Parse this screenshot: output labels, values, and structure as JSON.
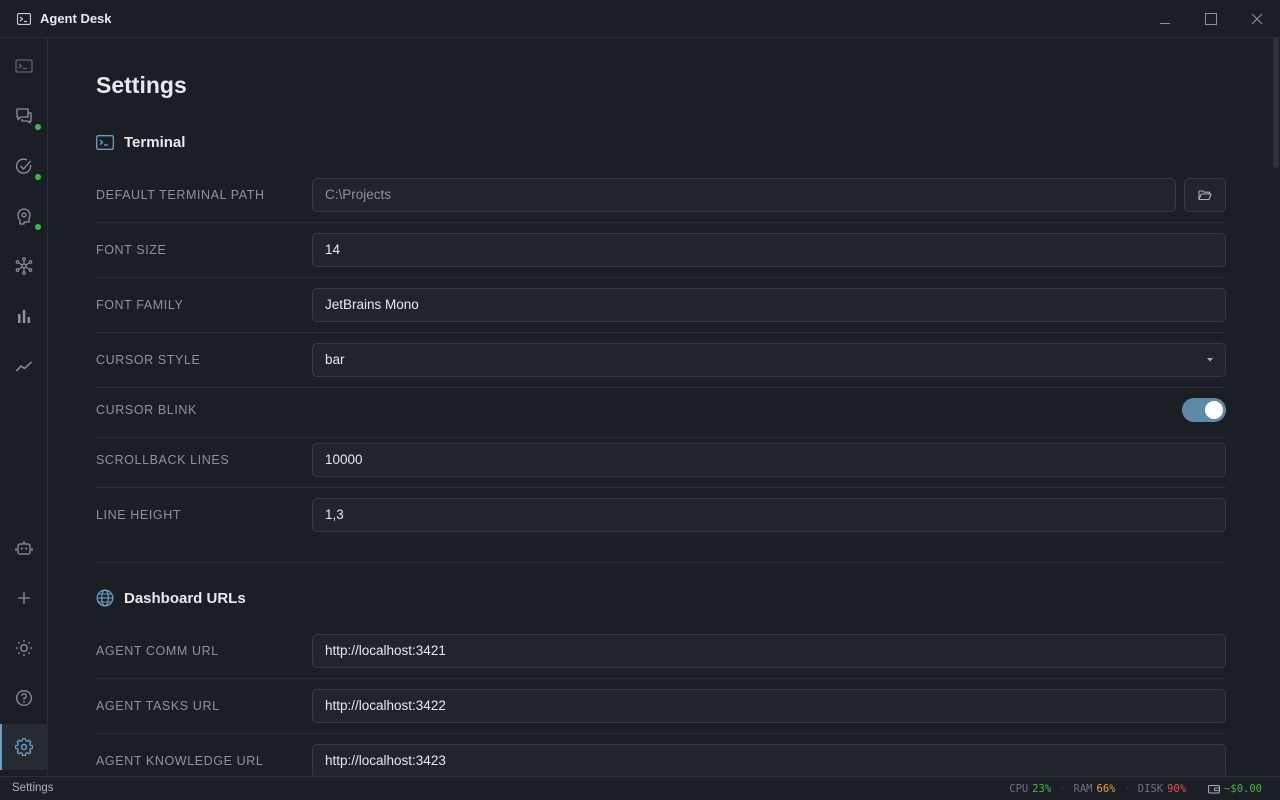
{
  "app": {
    "title": "Agent Desk"
  },
  "page": {
    "title": "Settings"
  },
  "sections": {
    "terminal": {
      "title": "Terminal",
      "rows": {
        "default_path": {
          "label": "DEFAULT TERMINAL PATH",
          "value": "C:\\Projects"
        },
        "font_size": {
          "label": "FONT SIZE",
          "value": "14"
        },
        "font_family": {
          "label": "FONT FAMILY",
          "value": "JetBrains Mono"
        },
        "cursor_style": {
          "label": "CURSOR STYLE",
          "value": "bar"
        },
        "cursor_blink": {
          "label": "CURSOR BLINK",
          "value": true
        },
        "scrollback": {
          "label": "SCROLLBACK LINES",
          "value": "10000"
        },
        "line_height": {
          "label": "LINE HEIGHT",
          "value": "1,3"
        }
      }
    },
    "dashboard": {
      "title": "Dashboard URLs",
      "rows": {
        "comm": {
          "label": "AGENT COMM URL",
          "value": "http://localhost:3421"
        },
        "tasks": {
          "label": "AGENT TASKS URL",
          "value": "http://localhost:3422"
        },
        "knowledge": {
          "label": "AGENT KNOWLEDGE URL",
          "value": "http://localhost:3423"
        }
      }
    }
  },
  "statusbar": {
    "left": "Settings",
    "cpu_label": "CPU",
    "cpu_value": "23%",
    "ram_label": "RAM",
    "ram_value": "66%",
    "disk_label": "DISK",
    "disk_value": "90%",
    "cost": "~$0.00"
  },
  "colors": {
    "accent": "#5e8aa8",
    "ok": "#3fb950",
    "warn": "#e3a03c",
    "danger": "#e5534b"
  },
  "icons": [
    "terminal-icon",
    "chat-icon",
    "tasks-icon",
    "knowledge-icon",
    "graph-icon",
    "bar-chart-icon",
    "trend-icon",
    "robot-icon",
    "plus-icon",
    "sun-icon",
    "help-icon",
    "gear-icon"
  ]
}
